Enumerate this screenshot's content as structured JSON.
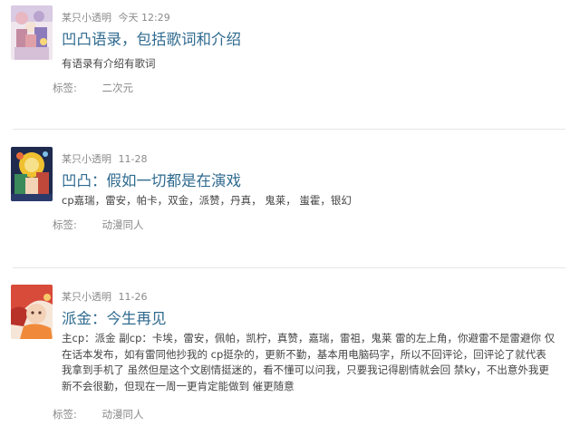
{
  "posts": [
    {
      "author": "某只小透明",
      "time": "今天 12:29",
      "title": "凹凸语录，包括歌词和介绍",
      "summary": "有语录有介绍有歌词",
      "tag_label": "标签:",
      "tag": "二次元",
      "avatar_colors": [
        "#f1d6de",
        "#b9a4d0",
        "#e0a0a8"
      ]
    },
    {
      "author": "某只小透明",
      "time": "11-28",
      "title": "凹凸：假如一切都是在演戏",
      "summary": "cp嘉瑞，雷安，帕卡，双金，派赞，丹真， 鬼莱， 蚩霍，银幻",
      "tag_label": "标签:",
      "tag": "动漫同人",
      "avatar_colors": [
        "#2a3a6a",
        "#f0c030",
        "#3a8a5a"
      ]
    },
    {
      "author": "某只小透明",
      "time": "11-26",
      "title": "派金：今生再见",
      "summary": "主cp：派金 副cp：卡埃，雷安，佩帕，凯柠，真赞，嘉瑞，雷祖，鬼莱 雷的左上角，你避雷不是雷避你 仅在话本发布，如有雷同他抄我的 cp挺杂的，更新不勤，基本用电脑码字，所以不回评论，回评论了就代表我拿到手机了 虽然但是这个文剧情挺迷的，看不懂可以问我，只要我记得剧情就会回 禁ky，不出意外我更新不会很勤，但现在一周一更肯定能做到 催更随意",
      "tag_label": "标签:",
      "tag": "动漫同人",
      "avatar_colors": [
        "#d84a3a",
        "#f3d2b8",
        "#f08a3a"
      ]
    }
  ]
}
